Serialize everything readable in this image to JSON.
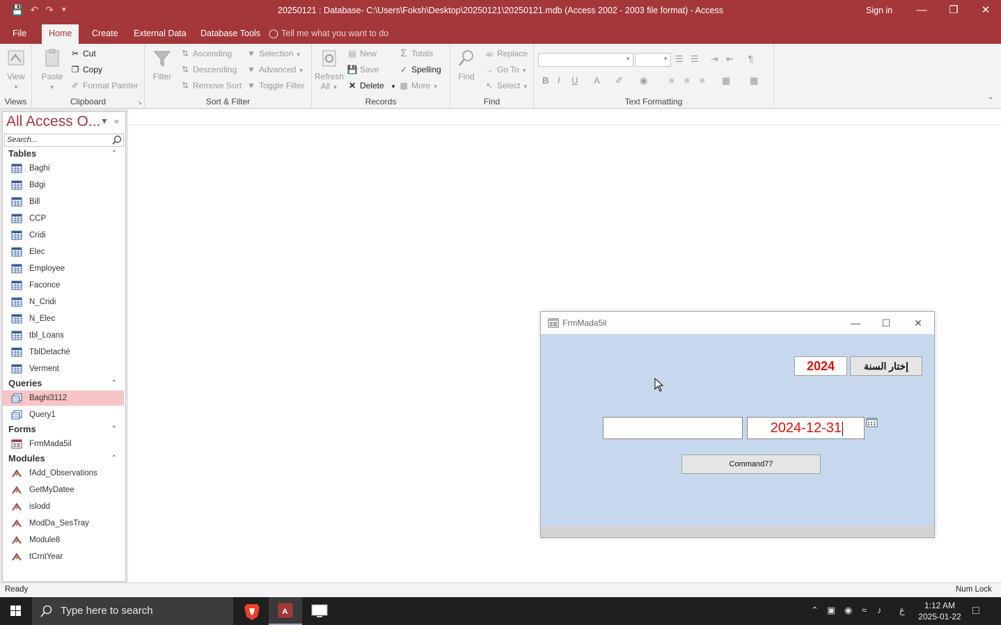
{
  "window": {
    "title": "20250121 : Database- C:\\Users\\Foksh\\Desktop\\20250121\\20250121.mdb (Access 2002 - 2003 file format)  -  Access",
    "sign_in": "Sign in"
  },
  "ribbon_tabs": [
    "File",
    "Home",
    "Create",
    "External Data",
    "Database Tools"
  ],
  "tell_me": "Tell me what you want to do",
  "ribbon": {
    "views": {
      "view": "View",
      "label": "Views"
    },
    "clipboard": {
      "paste": "Paste",
      "cut": "Cut",
      "copy": "Copy",
      "format_painter": "Format Painter",
      "label": "Clipboard"
    },
    "sort_filter": {
      "filter": "Filter",
      "ascending": "Ascending",
      "descending": "Descending",
      "remove_sort": "Remove Sort",
      "selection": "Selection",
      "advanced": "Advanced",
      "toggle_filter": "Toggle Filter",
      "label": "Sort & Filter"
    },
    "records": {
      "refresh": "Refresh",
      "refresh_sub": "All",
      "new": "New",
      "save": "Save",
      "delete": "Delete",
      "totals": "Totals",
      "spelling": "Spelling",
      "more": "More",
      "label": "Records"
    },
    "find": {
      "find": "Find",
      "replace": "Replace",
      "goto": "Go To",
      "select": "Select",
      "label": "Find"
    },
    "text_formatting": {
      "label": "Text Formatting"
    }
  },
  "nav": {
    "header": "All Access O...",
    "search_placeholder": "Search...",
    "sections": {
      "tables": {
        "label": "Tables",
        "items": [
          "Baghi",
          "Bdgi",
          "Bill",
          "CCP",
          "Cridi",
          "Elec",
          "Employee",
          "Faconce",
          "N_Cridi",
          "N_Elec",
          "tbl_Loans",
          "TblDetaché",
          "Verment"
        ]
      },
      "queries": {
        "label": "Queries",
        "items": [
          "Baghi3112",
          "Query1"
        ]
      },
      "forms": {
        "label": "Forms",
        "items": [
          "FrmMada5il"
        ]
      },
      "modules": {
        "label": "Modules",
        "items": [
          "fAdd_Observations",
          "GetMyDatee",
          "islodd",
          "ModDa_SesTray",
          "Module8",
          "tCrntYear"
        ]
      }
    },
    "selected_item": "Baghi3112"
  },
  "form": {
    "title": "FrmMada5il",
    "year_value": "2024",
    "year_button": "إختار السنة",
    "left_text": "",
    "date_value": "2024-12-31",
    "command_button": "Command77"
  },
  "status": {
    "left": "Ready",
    "right": "Num Lock"
  },
  "taskbar": {
    "search_placeholder": "Type here to search",
    "lang": "ع",
    "time": "1:12 AM",
    "date": "2025-01-22"
  },
  "colors": {
    "accent": "#a4373a",
    "form_bg": "#c7d8ee",
    "value_red": "#e01010"
  }
}
